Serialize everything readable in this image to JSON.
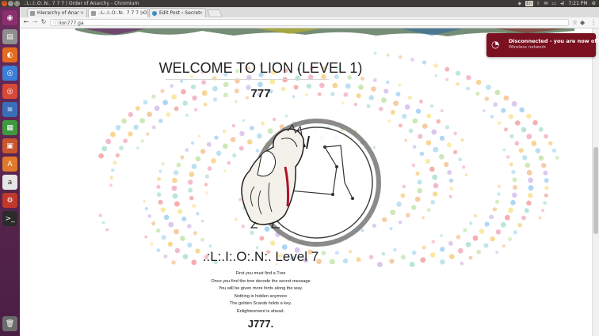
{
  "os": {
    "window_title": ".:L:.I:.O:.N:. 7 7 7 | Order of Anarchy - Chromium",
    "clock": "7:21 PM",
    "tray_icons": [
      "network-icon",
      "keyboard-layout-icon",
      "bluetooth-icon",
      "mail-icon",
      "battery-icon",
      "volume-icon"
    ],
    "keyboard_layout": "En"
  },
  "launcher": {
    "items": [
      {
        "name": "ubuntu-dash-icon",
        "glyph": "◉",
        "color": "#8b2f6e"
      },
      {
        "name": "files-icon",
        "glyph": "▤",
        "color": "#8f8f8f"
      },
      {
        "name": "firefox-icon",
        "glyph": "◐",
        "color": "#e56b1f"
      },
      {
        "name": "chromium-icon",
        "glyph": "◎",
        "color": "#3b7fd6"
      },
      {
        "name": "chrome-icon",
        "glyph": "◎",
        "color": "#d84a38"
      },
      {
        "name": "writer-icon",
        "glyph": "≡",
        "color": "#3a6fb7"
      },
      {
        "name": "calc-icon",
        "glyph": "▦",
        "color": "#3f9a3f"
      },
      {
        "name": "impress-icon",
        "glyph": "▣",
        "color": "#c8562e"
      },
      {
        "name": "software-center-icon",
        "glyph": "A",
        "color": "#e07a2a"
      },
      {
        "name": "amazon-icon",
        "glyph": "a",
        "color": "#e6e6e6"
      },
      {
        "name": "settings-icon",
        "glyph": "⚙",
        "color": "#c0392b"
      },
      {
        "name": "terminal-icon",
        "glyph": ">_",
        "color": "#2b2b2b"
      },
      {
        "name": "trash-icon",
        "glyph": "🗑",
        "color": "#6c6c6c"
      }
    ]
  },
  "browser": {
    "tabs": [
      {
        "label": "Hierarchy of Anar",
        "active": false,
        "favicon_color": "#9a9a9a"
      },
      {
        "label": ".:L:.I:.O:.N:. 7 7 7 | O",
        "active": true,
        "favicon_color": "#9a9a9a"
      },
      {
        "label": "Edit Post ‹ Secret",
        "active": false,
        "favicon_color": "#3c8fc7"
      }
    ],
    "url": "lion777.ga"
  },
  "notification": {
    "title": "Disconnected - you are now offline",
    "subtitle": "Wireless network"
  },
  "page": {
    "heading": "WELCOME TO LION (LEVEL 1)",
    "number": "777",
    "level_title": ".:L:.I:.O:.N:. Level 7",
    "riddle_lines": [
      "First you must find a Tree",
      "Once you find the tree decode the secret message",
      "You will be given more hints along the way.",
      "Nothing is hidden anymore",
      "The golden Scarab holds a key.",
      "Enlightenment is ahead."
    ],
    "signature": "J777."
  },
  "colors": {
    "notification_bg": "#7a1020",
    "launcher_bg": "#5e2750",
    "panel_bg": "#3c3b37"
  }
}
